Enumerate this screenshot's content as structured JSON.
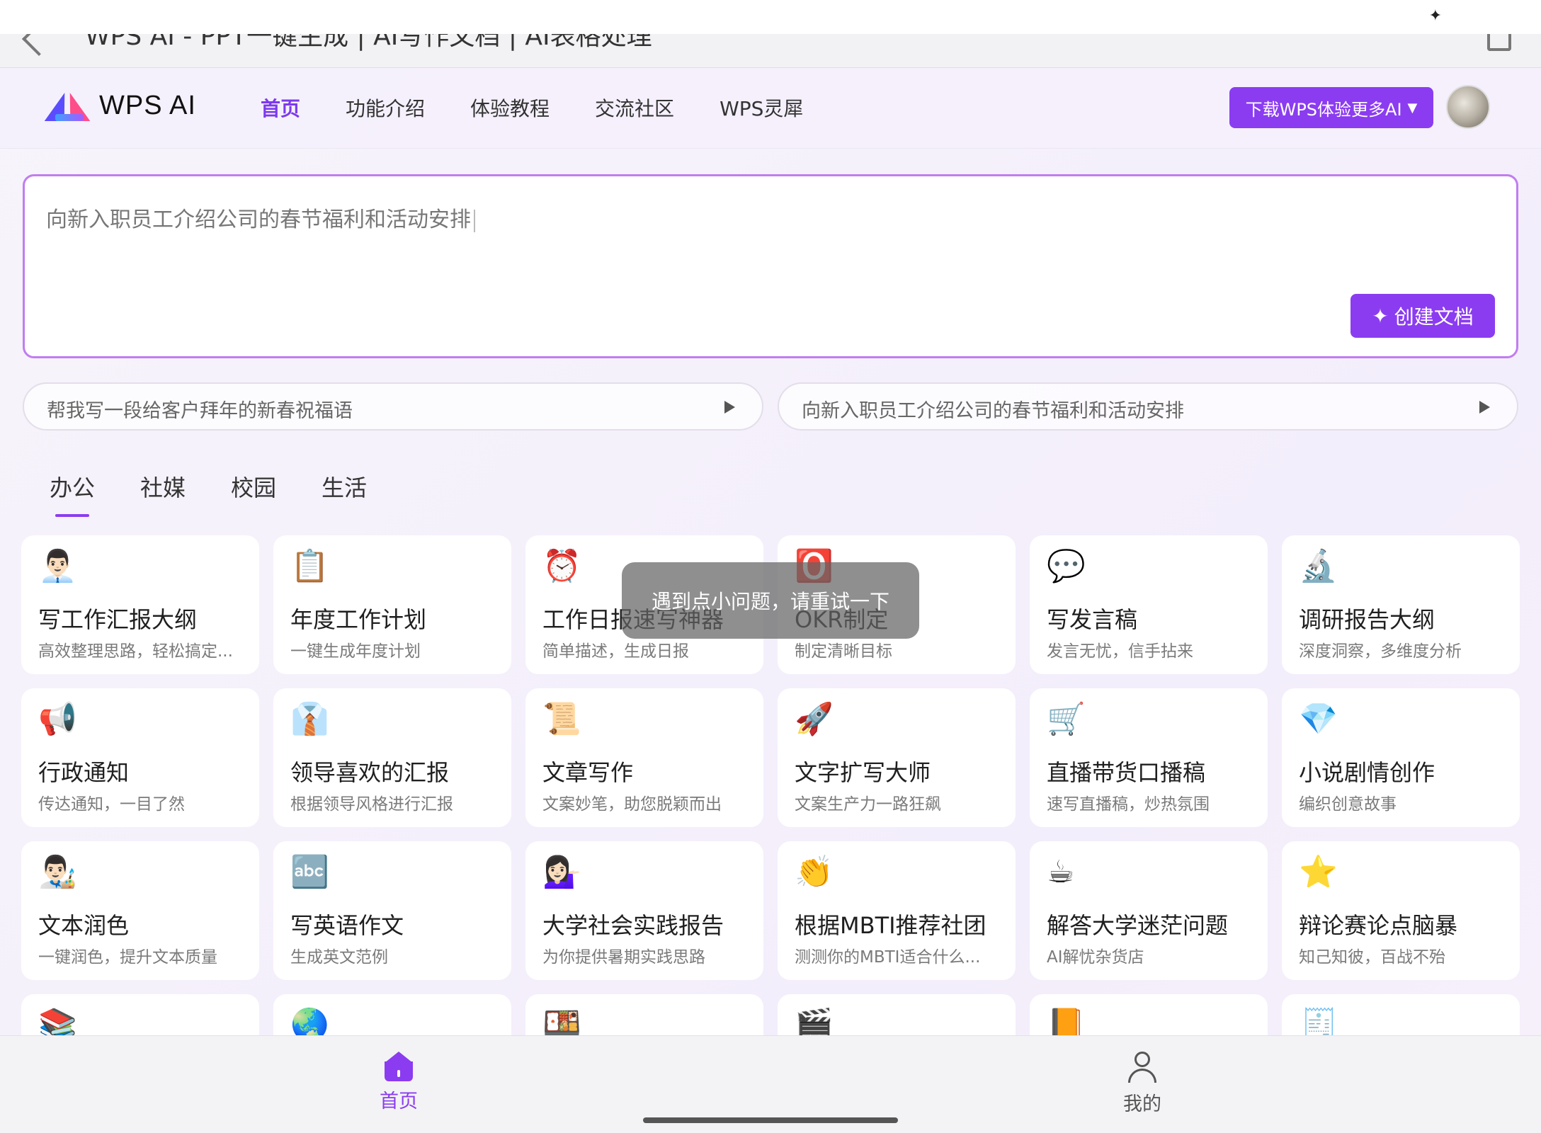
{
  "browser": {
    "page_title": "WPS AI - PPT一键生成 | AI写作文档 | AI表格处理"
  },
  "header": {
    "logo_text": "WPS AI",
    "nav": [
      {
        "label": "首页",
        "active": true
      },
      {
        "label": "功能介绍",
        "active": false
      },
      {
        "label": "体验教程",
        "active": false
      },
      {
        "label": "交流社区",
        "active": false
      },
      {
        "label": "WPS灵犀",
        "active": false
      }
    ],
    "download_label": "下载WPS体验更多AI",
    "accent_color": "#8b3cf0"
  },
  "prompt": {
    "text": "向新入职员工介绍公司的春节福利和活动安排",
    "create_label": "创建文档"
  },
  "suggestions": [
    "帮我写一段给客户拜年的新春祝福语",
    "向新入职员工介绍公司的春节福利和活动安排"
  ],
  "tabs": [
    {
      "label": "办公",
      "active": true
    },
    {
      "label": "社媒",
      "active": false
    },
    {
      "label": "校园",
      "active": false
    },
    {
      "label": "生活",
      "active": false
    }
  ],
  "cards": [
    {
      "icon": "👨🏻‍💼",
      "icon_name": "office-worker-icon",
      "title": "写工作汇报大纲",
      "desc": "高效整理思路，轻松搞定..."
    },
    {
      "icon": "📋",
      "icon_name": "clipboard-icon",
      "title": "年度工作计划",
      "desc": "一键生成年度计划"
    },
    {
      "icon": "⏰",
      "icon_name": "alarm-clock-icon",
      "title": "工作日报速写神器",
      "desc": "简单描述，生成日报"
    },
    {
      "icon": "🅾️",
      "icon_name": "o-button-icon",
      "title": "OKR制定",
      "desc": "制定清晰目标"
    },
    {
      "icon": "💬",
      "icon_name": "speech-bubble-icon",
      "title": "写发言稿",
      "desc": "发言无忧，信手拈来"
    },
    {
      "icon": "🔬",
      "icon_name": "microscope-icon",
      "title": "调研报告大纲",
      "desc": "深度洞察，多维度分析"
    },
    {
      "icon": "📢",
      "icon_name": "loudspeaker-icon",
      "title": "行政通知",
      "desc": "传达通知，一目了然"
    },
    {
      "icon": "👔",
      "icon_name": "necktie-icon",
      "title": "领导喜欢的汇报",
      "desc": "根据领导风格进行汇报"
    },
    {
      "icon": "📜",
      "icon_name": "scroll-icon",
      "title": "文章写作",
      "desc": "文案妙笔，助您脱颖而出"
    },
    {
      "icon": "🚀",
      "icon_name": "rocket-icon",
      "title": "文字扩写大师",
      "desc": "文案生产力一路狂飙"
    },
    {
      "icon": "🛒",
      "icon_name": "shopping-cart-icon",
      "title": "直播带货口播稿",
      "desc": "速写直播稿，炒热氛围"
    },
    {
      "icon": "💎",
      "icon_name": "gem-icon",
      "title": "小说剧情创作",
      "desc": "编织创意故事"
    },
    {
      "icon": "👨🏻‍🎨",
      "icon_name": "artist-icon",
      "title": "文本润色",
      "desc": "一键润色，提升文本质量"
    },
    {
      "icon": "🔤",
      "icon_name": "abcd-icon",
      "title": "写英语作文",
      "desc": "生成英文范例"
    },
    {
      "icon": "💁🏻‍♀️",
      "icon_name": "person-tipping-hand-icon",
      "title": "大学社会实践报告",
      "desc": "为你提供暑期实践思路"
    },
    {
      "icon": "👏",
      "icon_name": "clapping-hands-icon",
      "title": "根据MBTI推荐社团",
      "desc": "测测你的MBTI适合什么..."
    },
    {
      "icon": "☕",
      "icon_name": "coffee-icon",
      "title": "解答大学迷茫问题",
      "desc": "AI解忧杂货店"
    },
    {
      "icon": "⭐",
      "icon_name": "star-icon",
      "title": "辩论赛论点脑暴",
      "desc": "知己知彼，百战不殆"
    },
    {
      "icon": "📚",
      "icon_name": "books-icon",
      "title": "",
      "desc": ""
    },
    {
      "icon": "🌏",
      "icon_name": "globe-icon",
      "title": "",
      "desc": ""
    },
    {
      "icon": "🍱",
      "icon_name": "bento-icon",
      "title": "",
      "desc": ""
    },
    {
      "icon": "🎬",
      "icon_name": "clapper-board-icon",
      "title": "",
      "desc": ""
    },
    {
      "icon": "📙",
      "icon_name": "orange-book-icon",
      "title": "",
      "desc": ""
    },
    {
      "icon": "🧾",
      "icon_name": "receipt-icon",
      "title": "",
      "desc": ""
    }
  ],
  "toast": {
    "message": "遇到点小问题，请重试一下"
  },
  "bottom_nav": [
    {
      "label": "首页",
      "active": true
    },
    {
      "label": "我的",
      "active": false
    }
  ]
}
